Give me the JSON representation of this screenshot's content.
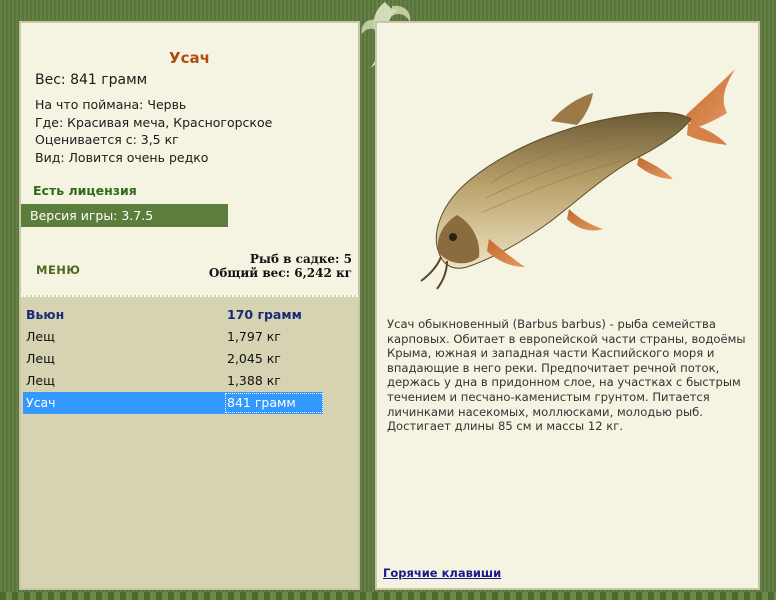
{
  "fish": {
    "name": "Усач",
    "weight_line": "Вес: 841 грамм",
    "caught_on": "На что поймана: Червь",
    "location": "Где: Красивая меча, Красногорское",
    "valued_from": "Оценивается с: 3,5 кг",
    "rarity": "Вид: Ловится очень редко",
    "description": "Усач обыкновенный (Barbus barbus) - рыба семейства карповых. Обитает в европейской части страны, водоёмы Крыма, южная и западная части Каспийского моря и впадающие в него реки. Предпочитает речной поток, держась у дна в придонном слое, на участках с быстрым течением и песчано-каменистым грунтом. Питается личинками насекомых, моллюсками, молодью рыб. Достигает длины 85 см и массы 12 кг.",
    "image_icon": "barbel-fish-image"
  },
  "license": "Есть лицензия",
  "version": "Версия игры: 3.7.5",
  "menu_label": "МЕНЮ",
  "cage": {
    "count_line": "Рыб в садке: 5",
    "total_line": "Общий вес: 6,242 кг"
  },
  "catch_list": [
    {
      "name": "Вьюн",
      "weight": "170 грамм"
    },
    {
      "name": "Лещ",
      "weight": "1,797 кг"
    },
    {
      "name": "Лещ",
      "weight": "2,045 кг"
    },
    {
      "name": "Лещ",
      "weight": "1,388 кг"
    },
    {
      "name": "Усач",
      "weight": "841 грамм"
    }
  ],
  "hotkeys_label": "Горячие клавиши",
  "colors": {
    "frame": "#5e7b3f",
    "panel": "#f5f3e2",
    "title": "#b34a12",
    "selection": "#3399ff"
  }
}
